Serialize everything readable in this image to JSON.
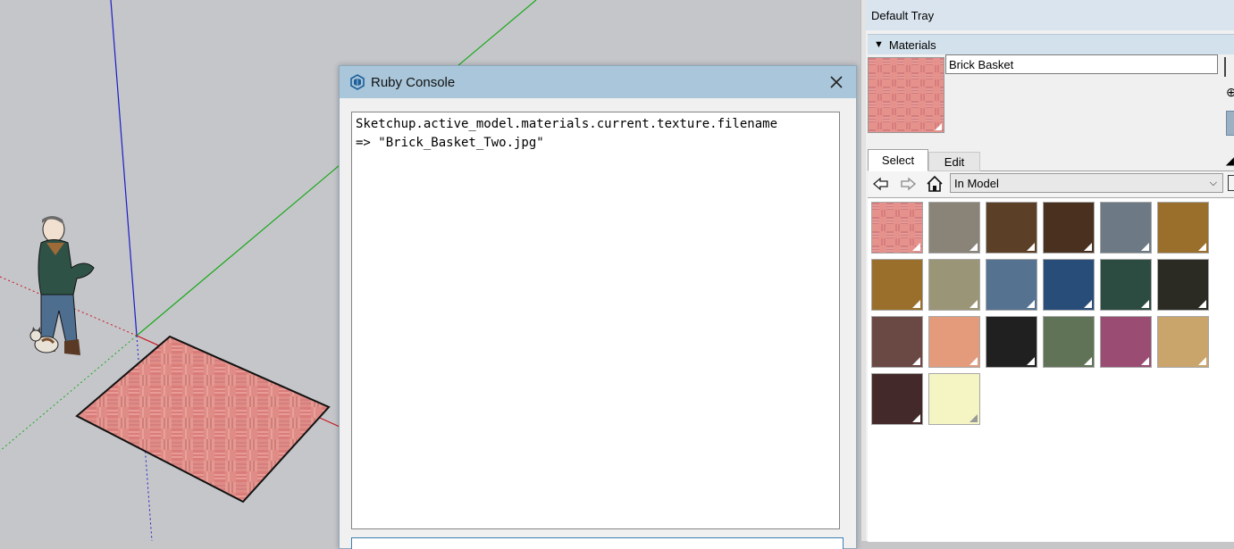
{
  "console": {
    "title": "Ruby Console",
    "lines": [
      "Sketchup.active_model.materials.current.texture.filename",
      "=> \"Brick_Basket_Two.jpg\""
    ]
  },
  "tray": {
    "title": "Default Tray",
    "panel_title": "Materials",
    "material_name": "Brick Basket",
    "tabs": [
      {
        "label": "Select"
      },
      {
        "label": "Edit"
      }
    ],
    "collection": "In Model",
    "swatches": [
      "brick-texture",
      "#8a8478",
      "#5c3f27",
      "#49301f",
      "#6d7a86",
      "#9a6f2c",
      "#9a6f2c",
      "#9b9577",
      "#557291",
      "#294d79",
      "#2c4b41",
      "#2b2b23",
      "#6a4843",
      "#e39b7c",
      "#202020",
      "#617357",
      "#9a4c72",
      "#c9a46b",
      "#43292a",
      "#f5f5c4"
    ]
  },
  "colors": {
    "tray_header": "#d3e1ec",
    "console_title": "#a9c6da",
    "viewport_bg": "#c5c6ca"
  }
}
